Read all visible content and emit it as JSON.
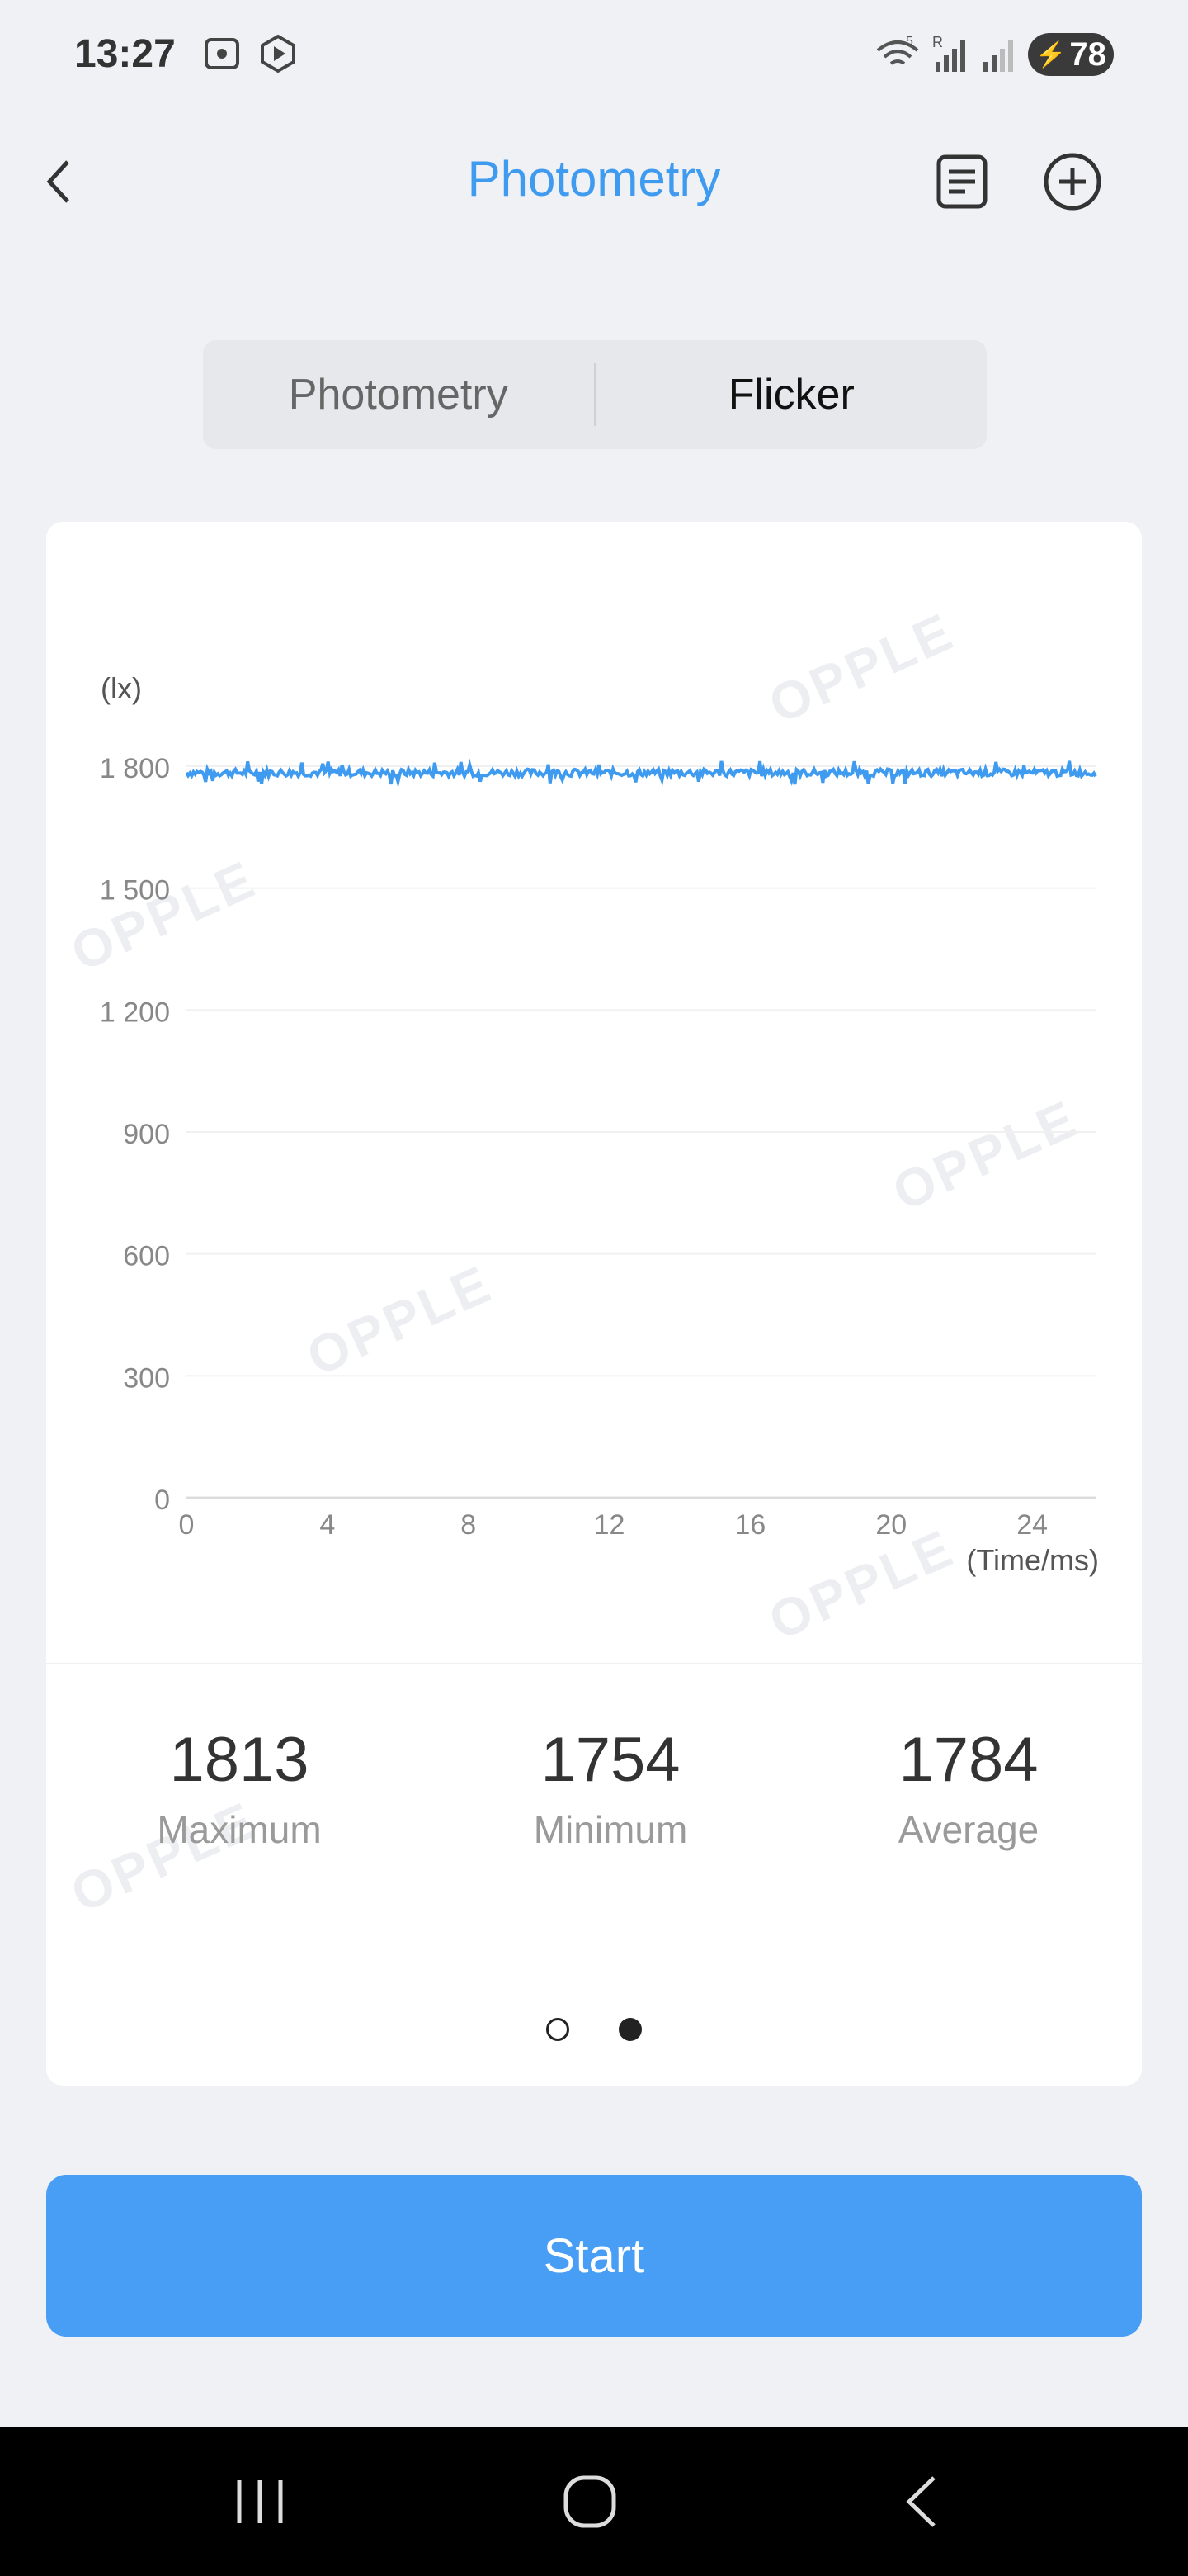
{
  "status_bar": {
    "time": "13:27",
    "battery": "78",
    "wifi_badge": "5",
    "signal_badge": "R"
  },
  "header": {
    "title": "Photometry",
    "back_icon": "chevron-left-icon",
    "doc_icon": "document-list-icon",
    "add_icon": "plus-circle-icon"
  },
  "tabs": [
    {
      "label": "Photometry",
      "active": false
    },
    {
      "label": "Flicker",
      "active": true
    }
  ],
  "watermark_text": "OPPLE",
  "chart_data": {
    "type": "line",
    "ylabel": "(lx)",
    "xlabel": "(Time/ms)",
    "xlim": [
      0,
      25.8
    ],
    "ylim": [
      0,
      1800
    ],
    "x_ticks": [
      "0",
      "4",
      "8",
      "12",
      "16",
      "20",
      "24"
    ],
    "y_ticks": [
      "0",
      "300",
      "600",
      "900",
      "1 200",
      "1 500",
      "1 800"
    ],
    "y_tick_values": [
      0,
      300,
      600,
      900,
      1200,
      1500,
      1800
    ],
    "x_tick_values": [
      0,
      4,
      8,
      12,
      16,
      20,
      24
    ],
    "grid": true,
    "series": [
      {
        "color": "#3f9bf0",
        "x_start": 0,
        "x_end": 25.8,
        "baseline": 1784,
        "min": 1754,
        "max": 1813
      }
    ]
  },
  "stats": [
    {
      "value": "1813",
      "label": "Maximum"
    },
    {
      "value": "1754",
      "label": "Minimum"
    },
    {
      "value": "1784",
      "label": "Average"
    }
  ],
  "pager": {
    "count": 2,
    "active_index": 1
  },
  "start_button": {
    "label": "Start"
  },
  "colors": {
    "accent": "#3f9bf0",
    "button": "#489ef5"
  }
}
